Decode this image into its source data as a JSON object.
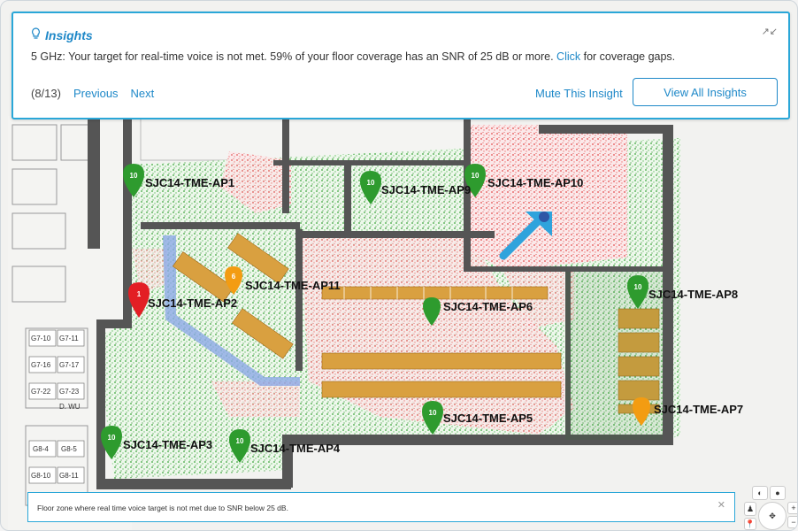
{
  "insights": {
    "title": "Insights",
    "message_pre": "5 GHz: Your target for real-time voice is not met. 59% of your floor coverage has an SNR of 25 dB or more.",
    "message_link": "Click",
    "message_post": "for coverage gaps.",
    "counter": "(8/13)",
    "previous": "Previous",
    "next": "Next",
    "mute": "Mute This Insight",
    "view_all": "View All Insights"
  },
  "access_points": [
    {
      "name": "SJC14-TME-AP1",
      "badge": "10"
    },
    {
      "name": "SJC14-TME-AP9",
      "badge": "10"
    },
    {
      "name": "SJC14-TME-AP10",
      "badge": "10"
    },
    {
      "name": "SJC14-TME-AP11",
      "badge": "6"
    },
    {
      "name": "SJC14-TME-AP2",
      "badge": "1"
    },
    {
      "name": "SJC14-TME-AP6",
      "badge": ""
    },
    {
      "name": "SJC14-TME-AP8",
      "badge": "10"
    },
    {
      "name": "SJC14-TME-AP7",
      "badge": ""
    },
    {
      "name": "SJC14-TME-AP5",
      "badge": "10"
    },
    {
      "name": "SJC14-TME-AP3",
      "badge": "10"
    },
    {
      "name": "SJC14-TME-AP4",
      "badge": "10"
    }
  ],
  "rooms": [
    "G7-10",
    "G7-11",
    "G7-16",
    "G7-17",
    "G7-22",
    "G7-23",
    "D. WU",
    "G8-4",
    "G8-5",
    "G8-10",
    "G8-11"
  ],
  "tooltip": {
    "text": "Floor zone where real time voice target is not met due to SNR below 25 dB."
  },
  "colors": {
    "accent": "#1e88c8",
    "good": "#2e9b2e",
    "bad": "#e03a3a",
    "warn": "#f39c12"
  }
}
